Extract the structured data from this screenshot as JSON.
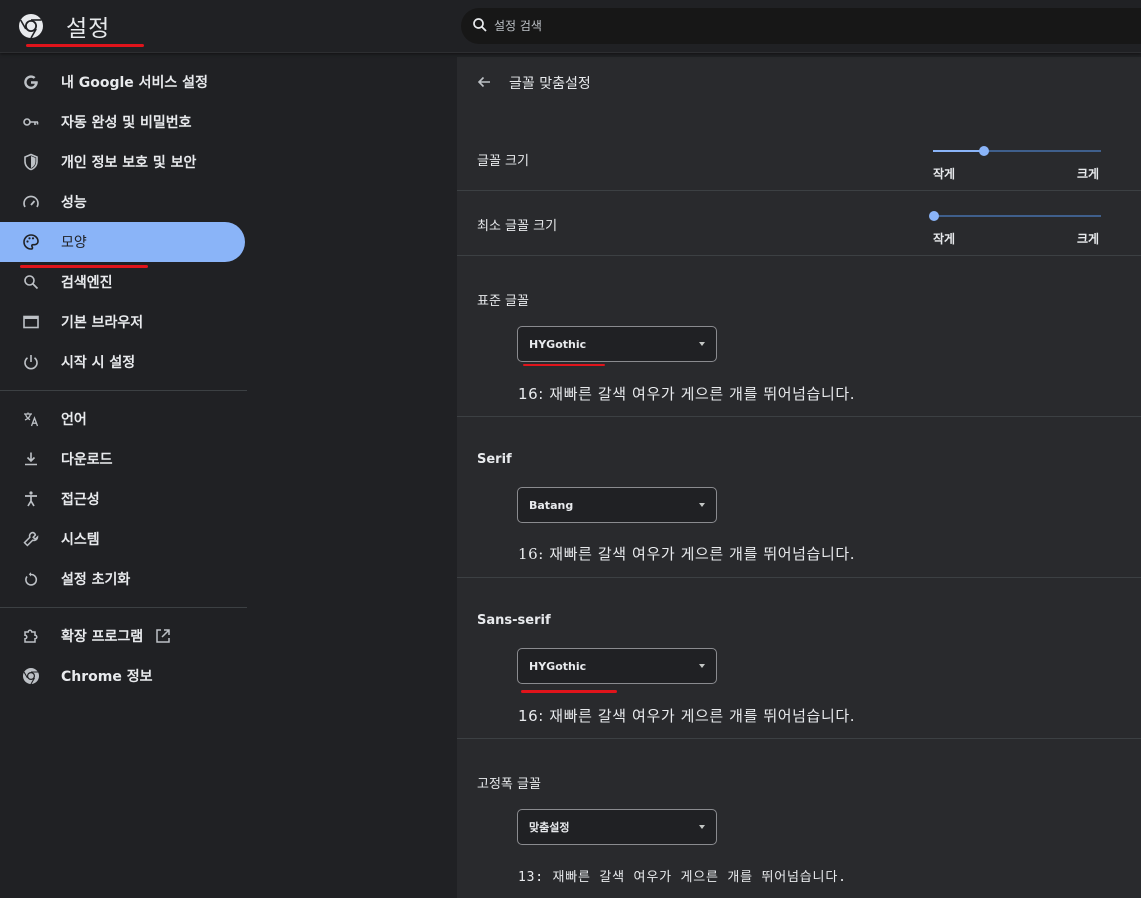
{
  "header": {
    "title": "설정",
    "logo_icon": "chrome-logo-icon",
    "search": {
      "placeholder": "설정 검색",
      "icon": "search-icon"
    }
  },
  "sidebar": {
    "items": [
      {
        "label": "내 Google 서비스 설정",
        "icon": "google-g-icon"
      },
      {
        "label": "자동 완성 및 비밀번호",
        "icon": "key-icon"
      },
      {
        "label": "개인 정보 보호 및 보안",
        "icon": "shield-icon"
      },
      {
        "label": "성능",
        "icon": "speedometer-icon"
      },
      {
        "label": "모양",
        "icon": "palette-icon",
        "active": true
      },
      {
        "label": "검색엔진",
        "icon": "search-icon"
      },
      {
        "label": "기본 브라우저",
        "icon": "browser-window-icon"
      },
      {
        "label": "시작 시 설정",
        "icon": "power-icon"
      }
    ],
    "items2": [
      {
        "label": "언어",
        "icon": "translate-icon"
      },
      {
        "label": "다운로드",
        "icon": "download-icon"
      },
      {
        "label": "접근성",
        "icon": "accessibility-icon"
      },
      {
        "label": "시스템",
        "icon": "wrench-icon"
      },
      {
        "label": "설정 초기화",
        "icon": "reset-icon"
      }
    ],
    "items3": [
      {
        "label": "확장 프로그램",
        "icon": "puzzle-icon",
        "trailing_icon": "open-external-icon"
      },
      {
        "label": "Chrome 정보",
        "icon": "chrome-logo-icon"
      }
    ]
  },
  "main": {
    "title": "글꼴 맞춤설정",
    "back_icon": "arrow-back-icon",
    "font_size": {
      "label": "글꼴 크기",
      "min_label": "작게",
      "max_label": "크게",
      "value_fraction": 0.3
    },
    "min_font_size": {
      "label": "최소 글꼴 크기",
      "min_label": "작게",
      "max_label": "크게",
      "value_fraction": 0.0
    },
    "standard": {
      "label": "표준 글꼴",
      "value": "HYGothic",
      "preview": "16: 재빠른 갈색 여우가 게으른 개를 뛰어넘습니다."
    },
    "serif": {
      "label": "Serif",
      "value": "Batang",
      "preview": "16: 재빠른 갈색 여우가 게으른 개를 뛰어넘습니다."
    },
    "sans_serif": {
      "label": "Sans-serif",
      "value": "HYGothic",
      "preview": "16: 재빠른 갈색 여우가 게으른 개를 뛰어넘습니다."
    },
    "fixed_width": {
      "label": "고정폭 글꼴",
      "value": "맞춤설정",
      "preview": "13: 재빠른 갈색 여우가 게으른 개를 뛰어넘습니다."
    }
  },
  "colors": {
    "background": "#202124",
    "panel": "#292a2d",
    "accent": "#8ab4f8",
    "annotation_red": "#e0141b"
  }
}
